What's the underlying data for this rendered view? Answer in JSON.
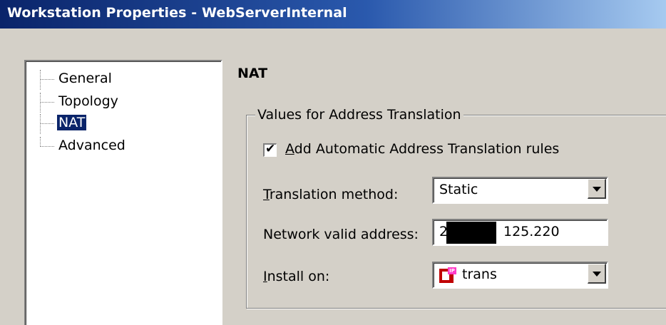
{
  "window": {
    "title": "Workstation Properties - WebServerInternal"
  },
  "tree": {
    "items": [
      {
        "label": "General",
        "selected": false
      },
      {
        "label": "Topology",
        "selected": false
      },
      {
        "label": "NAT",
        "selected": true
      },
      {
        "label": "Advanced",
        "selected": false
      }
    ]
  },
  "panel": {
    "title": "NAT",
    "group_label": "Values for  Address Translation",
    "auto_nat": {
      "checked": true,
      "label_accel": "A",
      "label_rest": "dd Automatic Address Translation rules"
    },
    "translation_method": {
      "label_accel": "T",
      "label_rest": "ranslation method:",
      "value": "Static"
    },
    "network_valid_address": {
      "label": "Network valid address:",
      "value_prefix": "2",
      "value_suffix": "125.220"
    },
    "install_on": {
      "label_accel": "I",
      "label_rest": "nstall on:",
      "value": "trans",
      "icon": "firewall-gateway-icon"
    }
  }
}
